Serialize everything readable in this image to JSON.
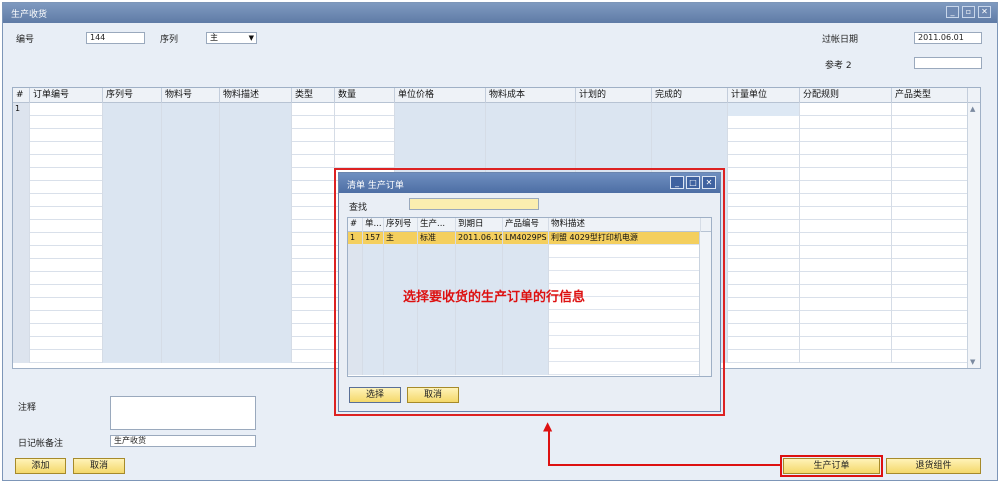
{
  "window": {
    "title": "生产收货",
    "controls": [
      "_",
      "▫",
      "✕"
    ]
  },
  "header": {
    "number_label": "编号",
    "number_value": "144",
    "series_label": "序列",
    "series_value": "主",
    "posting_date_label": "过帐日期",
    "posting_date_value": "2011.06.01",
    "ref2_label": "参考 2",
    "ref2_value": ""
  },
  "grid": {
    "columns": [
      "#",
      "订单编号",
      "序列号",
      "物料号",
      "物料描述",
      "类型",
      "数量",
      "单位价格",
      "物料成本",
      "计划的",
      "完成的",
      "计量单位",
      "分配规则",
      "产品类型"
    ],
    "first_row_num": "1"
  },
  "footer": {
    "remarks_label": "注释",
    "journal_label": "日记帐备注",
    "journal_value": "生产收货",
    "add_button": "添加",
    "cancel_button": "取消",
    "prod_order_button": "生产订单",
    "return_button": "退货组件"
  },
  "popup": {
    "title": "清单 生产订单",
    "search_label": "查找",
    "search_value": "",
    "columns": [
      "#",
      "单...",
      "序列号",
      "生产...",
      "到期日",
      "产品编号",
      "物料描述"
    ],
    "rows": [
      {
        "num": "1",
        "doc": "157",
        "series": "主",
        "type": "标准",
        "due": "2011.06.1C",
        "item": "LM4029PS",
        "desc": "利盟 4029型打印机电源"
      }
    ],
    "select_button": "选择",
    "cancel_button": "取消"
  },
  "annotation": "选择要收货的生产订单的行信息",
  "colors": {
    "highlight": "#f4cf5e",
    "annotation_red": "#dd1111",
    "title_blue": "#5f7ba6"
  }
}
